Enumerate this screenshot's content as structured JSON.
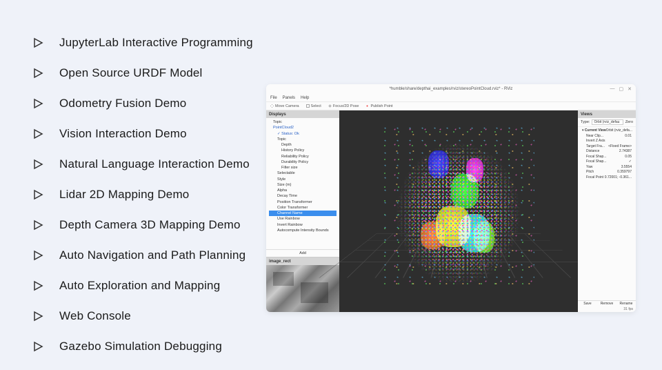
{
  "features": [
    "JupyterLab Interactive Programming",
    "Open Source URDF Model",
    "Odometry Fusion Demo",
    "Vision Interaction Demo",
    "Natural Language Interaction Demo",
    "Lidar 2D Mapping Demo",
    "Depth Camera 3D Mapping Demo",
    "Auto Navigation and Path Planning",
    "Auto Exploration and Mapping",
    "Web Console",
    "Gazebo Simulation Debugging"
  ],
  "rviz": {
    "title": "*humble/share/depthai_examples/rviz/stereoPointCloud.rviz* - RViz",
    "menus": [
      "File",
      "Panels",
      "Help"
    ],
    "tools": [
      "Move Camera",
      "Select",
      "Focus/2D Pose",
      "Publish Point"
    ],
    "displays": {
      "header": "Displays",
      "items": [
        {
          "label": "Topic",
          "indent": 1
        },
        {
          "label": "PointCloud2",
          "indent": 1,
          "blue": true
        },
        {
          "label": "✓ Status: Ok",
          "indent": 2,
          "blue": true
        },
        {
          "label": "Topic",
          "indent": 2
        },
        {
          "label": "Depth",
          "indent": 3
        },
        {
          "label": "History Policy",
          "indent": 3
        },
        {
          "label": "Reliability Policy",
          "indent": 3
        },
        {
          "label": "Durability Policy",
          "indent": 3
        },
        {
          "label": "Filter size",
          "indent": 3
        },
        {
          "label": "Selectable",
          "indent": 2
        },
        {
          "label": "Style",
          "indent": 2
        },
        {
          "label": "Size (m)",
          "indent": 2
        },
        {
          "label": "Alpha",
          "indent": 2
        },
        {
          "label": "Decay Time",
          "indent": 2
        },
        {
          "label": "Position Transformer",
          "indent": 2
        },
        {
          "label": "Color Transformer",
          "indent": 2
        },
        {
          "label": "Channel Name",
          "indent": 2,
          "sel": true
        },
        {
          "label": "Use Rainbow",
          "indent": 2
        },
        {
          "label": "Invert Rainbow",
          "indent": 2
        },
        {
          "label": "Autocompute Intensity Bounds",
          "indent": 2
        }
      ],
      "buttons": {
        "add": "Add"
      }
    },
    "image_rect": {
      "header": "image_rect"
    },
    "views": {
      "header": "Views",
      "type_label": "Type:",
      "type_value": "Orbit (rviz_defau",
      "zero": "Zero",
      "current_view": "Current View",
      "current_view_value": "Orbit (rviz_defa...",
      "props": [
        {
          "k": "Near Clip...",
          "v": "0.01"
        },
        {
          "k": "Invert Z Axis",
          "v": ""
        },
        {
          "k": "Target Fra...",
          "v": "<Fixed Frame>"
        },
        {
          "k": "Distance",
          "v": "2.74387"
        },
        {
          "k": "Focal Shap...",
          "v": "0.05"
        },
        {
          "k": "Focal Shap...",
          "v": "✓"
        },
        {
          "k": "Yaw",
          "v": "3.5554"
        },
        {
          "k": "Pitch",
          "v": "0.359797"
        },
        {
          "k": "Focal Point",
          "v": "0.72001; -0.361..."
        }
      ],
      "buttons": {
        "save": "Save",
        "remove": "Remove",
        "rename": "Rename"
      },
      "fps": "31 fps"
    }
  }
}
